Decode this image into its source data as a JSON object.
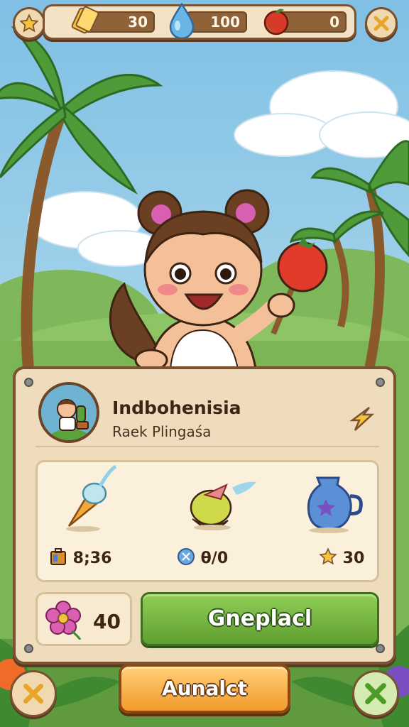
{
  "hud": {
    "coins": "30",
    "water": "100",
    "fruit": "0"
  },
  "character": {
    "name": "Indbohenisia",
    "subtitle": "Raek Plingaśa"
  },
  "items": [
    {
      "icon": "ice-cream-cone-icon",
      "stat_icon": "suitcase-icon",
      "stat": "8;36"
    },
    {
      "icon": "wrapped-fruit-icon",
      "stat_icon": "blue-token-icon",
      "stat": "θ/0"
    },
    {
      "icon": "blue-jug-icon",
      "stat_icon": "star-icon",
      "stat": "30"
    }
  ],
  "flowers": {
    "count": "40"
  },
  "buttons": {
    "primary": "Gneplacl",
    "secondary": "Aunalct"
  },
  "colors": {
    "panel": "#efdcbc",
    "frame": "#7a5231",
    "primary_green": "#6fb23c",
    "secondary_orange": "#f5a83a",
    "sky": "#8ec7e6"
  }
}
